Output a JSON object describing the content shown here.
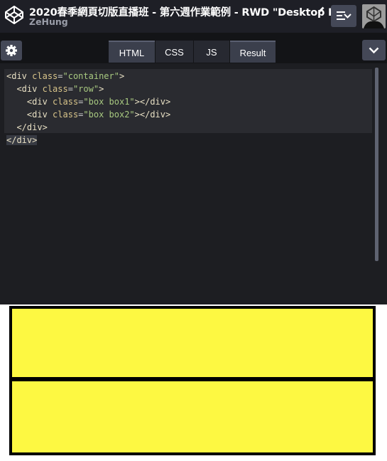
{
  "header": {
    "pen_title": "2020春季網頁切版直播班 - 第六週作業範例 - RWD \"Desktop Fi...",
    "author": "ZeHung"
  },
  "icons": {
    "logo": "codepen-logo-icon",
    "edit": "pencil-icon",
    "layout": "change-view-icon",
    "avatar": "user-avatar",
    "settings": "gear-icon",
    "collapse": "chevron-down-icon"
  },
  "tabs": [
    {
      "label": "HTML",
      "active": true
    },
    {
      "label": "CSS",
      "active": false
    },
    {
      "label": "JS",
      "active": false
    },
    {
      "label": "Result",
      "active": true
    }
  ],
  "code_lines": [
    "<div class=\"container\">",
    "  <div class=\"row\">",
    "    <div class=\"box box1\"></div>",
    "    <div class=\"box box2\"></div>",
    "  </div>",
    "</div>"
  ],
  "colors": {
    "box_fill": "#fdf842",
    "box_border": "#000000",
    "editor_bg": "#1d1e22",
    "topbar_bg": "#1e1f26"
  }
}
